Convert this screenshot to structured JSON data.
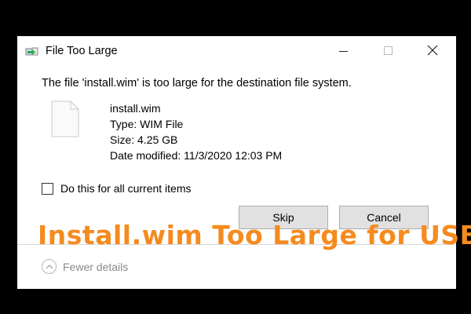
{
  "dialog": {
    "title": "File Too Large",
    "message": "The file 'install.wim' is too large for the destination file system.",
    "file": {
      "name": "install.wim",
      "type": "Type: WIM File",
      "size": "Size: 4.25 GB",
      "date_modified": "Date modified: 11/3/2020 12:03 PM"
    },
    "checkbox": {
      "label": "Do this for all current items",
      "checked": false
    },
    "buttons": {
      "skip": "Skip",
      "cancel": "Cancel"
    },
    "details_toggle": "Fewer details"
  },
  "overlay_caption": "Install.wim Too Large for USB",
  "icons": {
    "app": "copy-transfer-icon",
    "file": "blank-file-icon",
    "window": [
      "minimize-icon",
      "maximize-icon",
      "close-icon"
    ],
    "details": "chevron-up-icon"
  },
  "colors": {
    "caption": "#f58b1f",
    "button_bg": "#e1e1e1",
    "background": "#000000"
  }
}
